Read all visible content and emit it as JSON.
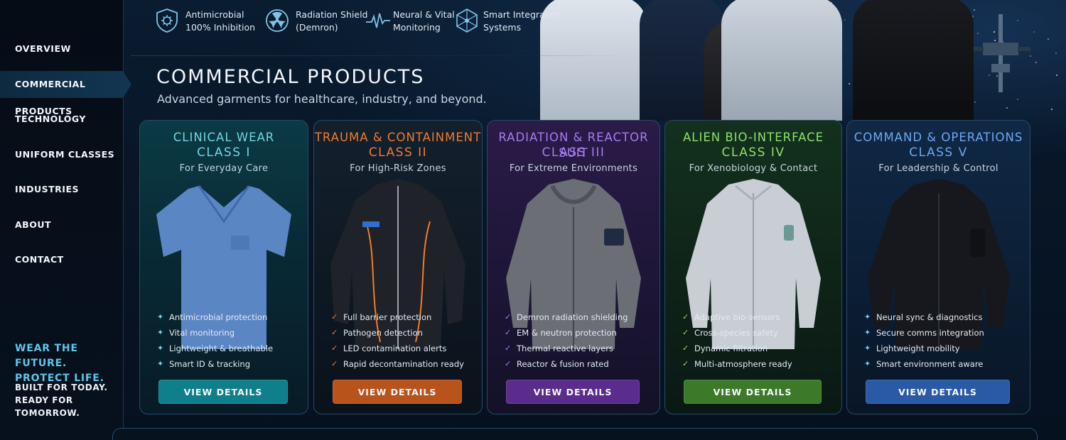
{
  "sidebar": {
    "items": [
      {
        "label": "OVERVIEW",
        "active": false
      },
      {
        "label": "COMMERCIAL PRODUCTS",
        "active": true
      },
      {
        "label": "TECHNOLOGY",
        "active": false
      },
      {
        "label": "UNIFORM CLASSES",
        "active": false
      },
      {
        "label": "INDUSTRIES",
        "active": false
      },
      {
        "label": "ABOUT",
        "active": false
      },
      {
        "label": "CONTACT",
        "active": false
      }
    ],
    "tagline": {
      "line1": "WEAR THE FUTURE.",
      "line2": "PROTECT LIFE."
    },
    "tagline2": {
      "line1": "BUILT FOR TODAY.",
      "line2": "READY FOR TOMORROW."
    }
  },
  "features": [
    {
      "icon": "shield-microbe-icon",
      "line1": "Antimicrobial",
      "line2": "100% Inhibition"
    },
    {
      "icon": "radiation-icon",
      "line1": "Radiation Shield",
      "line2": "(Demron)"
    },
    {
      "icon": "heartbeat-icon",
      "line1": "Neural & Vital",
      "line2": "Monitoring"
    },
    {
      "icon": "network-icon",
      "line1": "Smart Integrated",
      "line2": "Systems"
    }
  ],
  "section": {
    "title": "COMMERCIAL PRODUCTS",
    "subtitle": "Advanced garments for healthcare, industry, and beyond."
  },
  "cards": [
    {
      "title": "CLINICAL WEAR",
      "class": "CLASS I",
      "subtitle": "For Everyday Care",
      "accent": "#6fd6e0",
      "bullet_color": "#6fd6e0",
      "features": [
        "Antimicrobial protection",
        "Vital monitoring",
        "Lightweight & breathable",
        "Smart ID & tracking"
      ],
      "button": "VIEW DETAILS",
      "button_color": "#0f7f8c"
    },
    {
      "title": "TRAUMA & CONTAINMENT",
      "class": "CLASS II",
      "subtitle": "For High-Risk Zones",
      "accent": "#f07b2f",
      "bullet_color": "#f07b2f",
      "features": [
        "Full barrier protection",
        "Pathogen detection",
        "LED contamination alerts",
        "Rapid decontamination ready"
      ],
      "button": "VIEW DETAILS",
      "button_color": "#b9531c"
    },
    {
      "title": "RADIATION & REACTOR SUIT",
      "class": "CLASS III",
      "subtitle": "For Extreme Environments",
      "accent": "#a77bf0",
      "bullet_color": "#a77bf0",
      "features": [
        "Demron radiation shielding",
        "EM & neutron protection",
        "Thermal reactive layers",
        "Reactor & fusion rated"
      ],
      "button": "VIEW DETAILS",
      "button_color": "#5a2d8c"
    },
    {
      "title": "ALIEN BIO-INTERFACE",
      "class": "CLASS IV",
      "subtitle": "For Xenobiology & Contact",
      "accent": "#8fe06a",
      "bullet_color": "#8fe06a",
      "features": [
        "Adaptive bio-sensors",
        "Cross-species safety",
        "Dynamic filtration",
        "Multi-atmosphere ready"
      ],
      "button": "VIEW DETAILS",
      "button_color": "#3c7a2a"
    },
    {
      "title": "COMMAND & OPERATIONS",
      "class": "CLASS V",
      "subtitle": "For Leadership & Control",
      "accent": "#6fa6f0",
      "bullet_color": "#6fc6f0",
      "features": [
        "Neural sync & diagnostics",
        "Secure comms integration",
        "Lightweight mobility",
        "Smart environment aware"
      ],
      "button": "VIEW DETAILS",
      "button_color": "#2a5aa6"
    }
  ]
}
